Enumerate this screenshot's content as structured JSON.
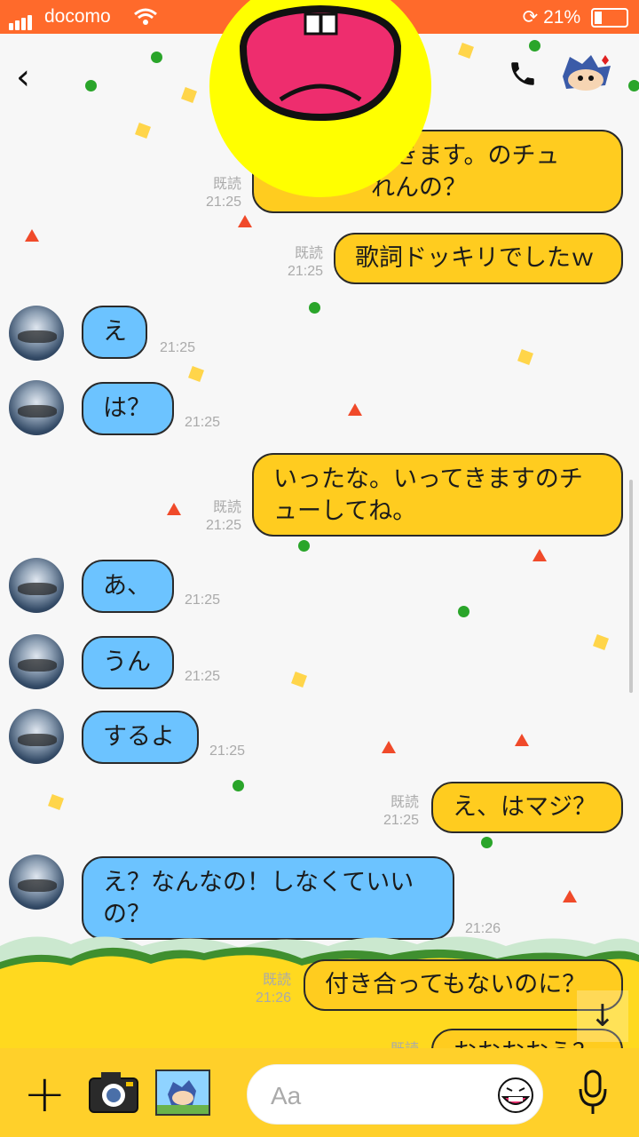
{
  "status": {
    "carrier": "docomo",
    "battery": "21%"
  },
  "messages": [
    {
      "side": "out",
      "line1": "てきます。のチュ",
      "line2": "れんの？",
      "read": "既読",
      "time": "21:25"
    },
    {
      "side": "out",
      "line1": "歌詞ドッキリでしたｗ",
      "read": "既読",
      "time": "21:25"
    },
    {
      "side": "in",
      "line1": "え",
      "time": "21:25"
    },
    {
      "side": "in",
      "line1": "は？",
      "time": "21:25"
    },
    {
      "side": "out",
      "line1": "いったな。いってきますのチ",
      "line2": "ューしてね。",
      "read": "既読",
      "time": "21:25"
    },
    {
      "side": "in",
      "line1": "あ、",
      "time": "21:25"
    },
    {
      "side": "in",
      "line1": "うん",
      "time": "21:25"
    },
    {
      "side": "in",
      "line1": "するよ",
      "time": "21:25"
    },
    {
      "side": "out",
      "line1": "え、はマジ？",
      "read": "既読",
      "time": "21:25"
    },
    {
      "side": "in",
      "line1": "え？なんなの！しなくていい",
      "line2": "の？",
      "time": "21:26"
    },
    {
      "side": "out",
      "line1": "付き合ってもないのに？",
      "read": "既読",
      "time": "21:26"
    },
    {
      "side": "out",
      "line1": "おおおおう？",
      "read": "既読"
    }
  ],
  "input": {
    "placeholder": "Aa"
  },
  "icons": {
    "back": "chevron-left-icon",
    "call": "phone-icon",
    "add": "plus-icon",
    "camera": "camera-icon",
    "image": "photo-icon",
    "emoji": "emoji-icon",
    "voice": "microphone-icon",
    "scroll_down": "arrow-down-icon"
  },
  "colors": {
    "header": "#ff6a2b",
    "incoming": "#6cc3ff",
    "outgoing": "#ffcc1f",
    "input_bar": "#ffd02a"
  }
}
